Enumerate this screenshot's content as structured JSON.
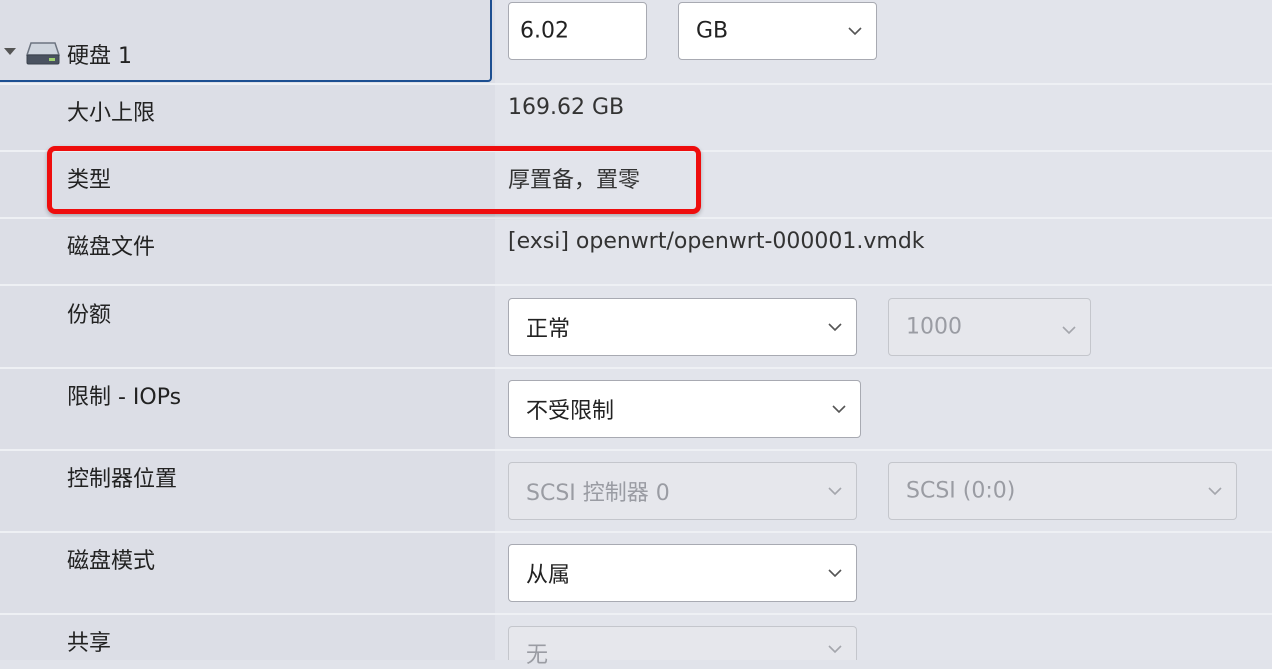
{
  "disk": {
    "title": "硬盘 1",
    "size_value": "6.02",
    "size_unit": "GB"
  },
  "rows": {
    "max_size": {
      "label": "大小上限",
      "value": "169.62 GB"
    },
    "type": {
      "label": "类型",
      "value": "厚置备，置零"
    },
    "disk_file": {
      "label": "磁盘文件",
      "value": "[exsi] openwrt/openwrt-000001.vmdk"
    },
    "shares": {
      "label": "份额",
      "select_value": "正常",
      "number_value": "1000"
    },
    "limit_iops": {
      "label": "限制 - IOPs",
      "select_value": "不受限制"
    },
    "controller_location": {
      "label": "控制器位置",
      "controller_value": "SCSI 控制器 0",
      "slot_value": "SCSI (0:0)"
    },
    "disk_mode": {
      "label": "磁盘模式",
      "select_value": "从属"
    },
    "sharing": {
      "label": "共享",
      "select_value": "无"
    }
  },
  "colors": {
    "highlight": "#ee0d0d",
    "focus_border": "#1d4f91"
  },
  "icons": {
    "expand": "caret-down-icon",
    "disk": "hard-disk-icon",
    "dropdown": "chevron-down-icon"
  }
}
